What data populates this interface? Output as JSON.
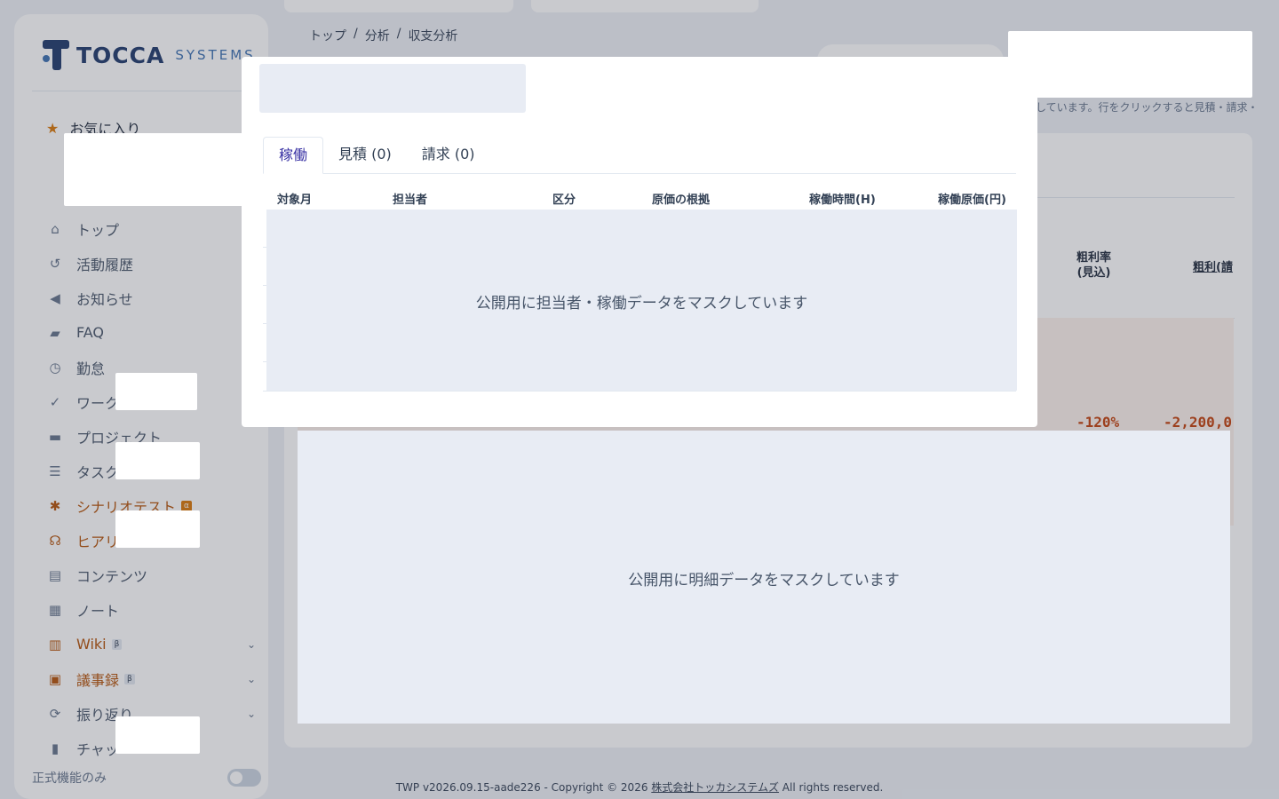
{
  "brand": {
    "name": "TOCCA",
    "sub": "SYSTEMS"
  },
  "sidebar": {
    "favorites_label": "お気に入り",
    "items": [
      {
        "label": "トップ",
        "icon": "home-icon",
        "color": "#475569"
      },
      {
        "label": "活動履歴",
        "icon": "history-icon",
        "color": "#475569"
      },
      {
        "label": "お知らせ",
        "icon": "megaphone-icon",
        "color": "#475569"
      },
      {
        "label": "FAQ",
        "icon": "chat-bubbles-icon",
        "color": "#475569"
      },
      {
        "label": "勤怠",
        "icon": "clock-icon",
        "color": "#475569"
      },
      {
        "label": "ワーク",
        "icon": "check-circle-icon",
        "color": "#475569"
      },
      {
        "label": "プロジェクト",
        "icon": "folder-icon",
        "color": "#475569"
      },
      {
        "label": "タスク",
        "icon": "checklist-icon",
        "color": "#475569"
      },
      {
        "label": "シナリオテスト",
        "icon": "bug-icon",
        "badge": "α",
        "color": "#b45309"
      },
      {
        "label": "ヒアリ",
        "icon": "voice-icon",
        "color": "#b45309"
      },
      {
        "label": "コンテンツ",
        "icon": "document-icon",
        "color": "#475569"
      },
      {
        "label": "ノート",
        "icon": "note-icon",
        "color": "#475569"
      },
      {
        "label": "Wiki",
        "icon": "book-icon",
        "badge": "β",
        "expandable": true,
        "color": "#b45309"
      },
      {
        "label": "議事録",
        "icon": "calendar-icon",
        "badge": "β",
        "expandable": true,
        "color": "#b45309"
      },
      {
        "label": "振り返り",
        "icon": "sync-icon",
        "expandable": true,
        "color": "#475569"
      },
      {
        "label": "チャッ",
        "icon": "chat-icon",
        "color": "#475569"
      }
    ],
    "footer_toggle_label": "正式機能のみ"
  },
  "breadcrumb": [
    "トップ",
    "分析",
    "収支分析"
  ],
  "page": {
    "hint_text": "しています。行をクリックすると見積・請求・",
    "col_gross_margin_rate": "粗利率\n(見込)",
    "col_gross_profit": "粗利(請",
    "row_values": {
      "margin_rate": "-120%",
      "gross_profit": "-2,200,0"
    },
    "detail_mask_note": "公開用に明細データをマスクしています"
  },
  "modal": {
    "tabs": [
      {
        "label": "稼働",
        "active": true
      },
      {
        "label": "見積 (0)",
        "active": false
      },
      {
        "label": "請求 (0)",
        "active": false
      }
    ],
    "columns": [
      "対象月",
      "担当者",
      "区分",
      "原価の根拠",
      "稼働時間(H)",
      "稼働原価(円)"
    ],
    "mask_note": "公開用に担当者・稼働データをマスクしています"
  },
  "footer": {
    "version": "TWP v2026.09.15-aade226 - Copyright © 2026",
    "company_link": "株式会社トッカシステムズ",
    "rights": "All rights reserved."
  },
  "colors": {
    "accent": "#3730a3",
    "warning": "#b45309",
    "negative": "#c2410c",
    "mask": "#e8ecf4"
  }
}
